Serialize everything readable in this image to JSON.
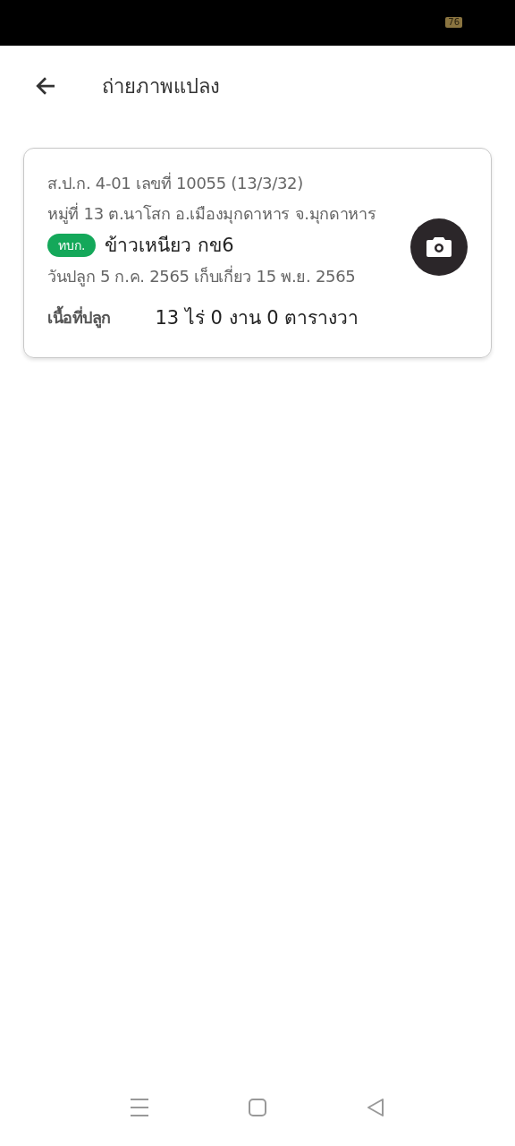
{
  "status_bar": {
    "battery": "76"
  },
  "header": {
    "title": "ถ่ายภาพแปลง"
  },
  "plot_card": {
    "document": "ส.ป.ก. 4-01 เลขที่ 10055 (13/3/32)",
    "address": "หมู่ที่ 13 ต.นาโสก อ.เมืองมุกดาหาร จ.มุกดาหาร",
    "tag": "ทบก.",
    "crop": "ข้าวเหนียว กข6",
    "dates": "วันปลูก 5 ก.ค. 2565 เก็บเกี่ยว 15 พ.ย. 2565",
    "area_label": "เนื้อที่ปลูก",
    "area_value": "13 ไร่ 0 งาน 0 ตารางวา"
  }
}
